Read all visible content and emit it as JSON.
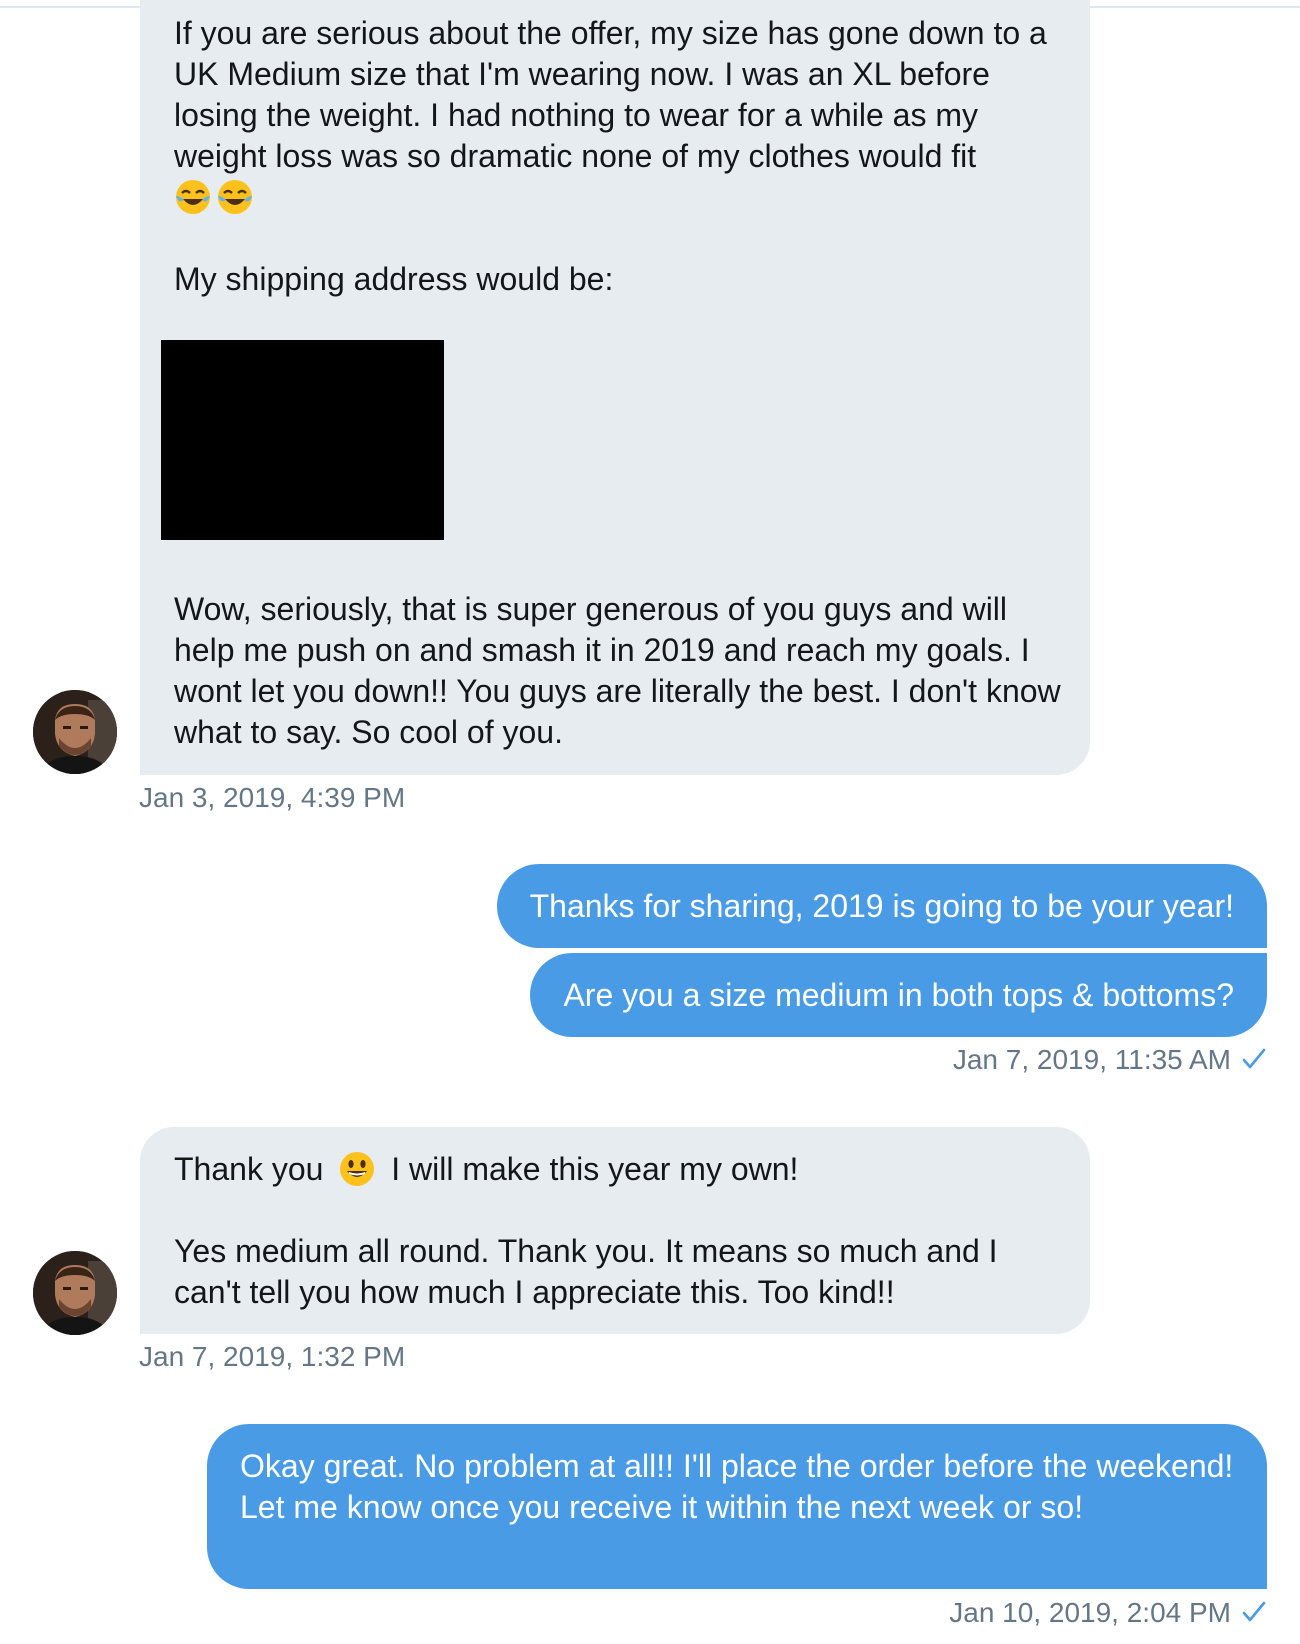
{
  "conversation": {
    "messages": [
      {
        "sender": "contact",
        "paragraphs": [
          "If you are serious about the offer, my size has gone down to a UK Medium size that I'm wearing now. I was an XL before losing the weight. I had nothing to wear for a while as my weight loss was so dramatic none of my clothes would fit",
          "My shipping address would be:",
          "Wow, seriously, that is super generous of you guys and will help me push on and smash it in 2019 and reach my goals. I wont let you down!! You guys are literally the best. I don't know what to say. So cool of you."
        ],
        "emoji": [
          "face-with-tears-of-joy",
          "face-with-tears-of-joy"
        ],
        "redacted_address": "black redaction box",
        "timestamp": "Jan 3, 2019, 4:39 PM"
      },
      {
        "sender": "me",
        "lines": [
          "Thanks for sharing, 2019 is going to be your year!",
          "Are you a size medium in both tops & bottoms?"
        ],
        "timestamp": "Jan 7, 2019, 11:35 AM",
        "read_receipt": "checkmark"
      },
      {
        "sender": "contact",
        "line1_before": "Thank you",
        "line1_after": "I will make this year my own!",
        "emoji": "smiling-face",
        "paragraph2": "Yes medium all round. Thank you. It means so much and I can't tell you how much I appreciate this. Too kind!!",
        "timestamp": "Jan 7, 2019, 1:32 PM"
      },
      {
        "sender": "me",
        "text": "Okay great. No problem at all!! I'll place the order before the weekend! Let me know once you receive it within the next week or so!",
        "timestamp": "Jan 10, 2019, 2:04 PM",
        "read_receipt": "checkmark"
      }
    ]
  },
  "colors": {
    "received_bubble": "#e6ecf0",
    "sent_bubble": "#4a9be6",
    "timestamp_text": "#657786",
    "checkmark": "#4a9be6"
  }
}
